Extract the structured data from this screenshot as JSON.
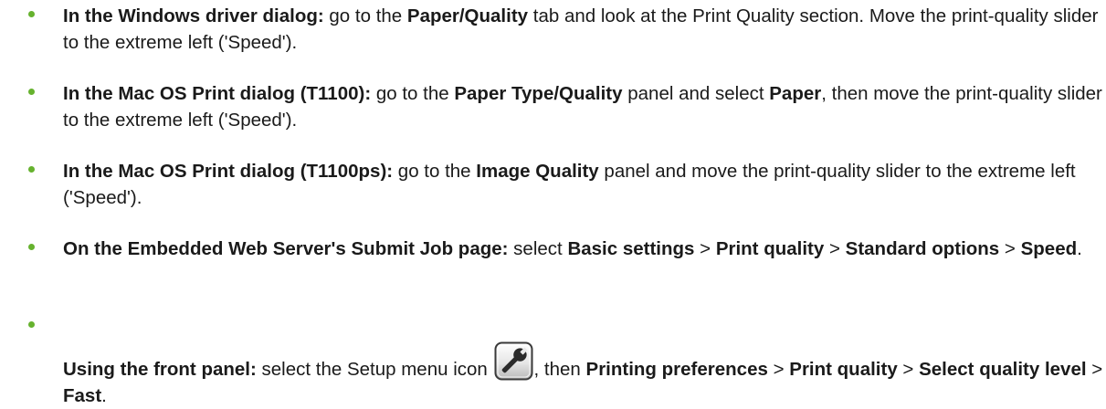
{
  "items": [
    {
      "lead": "In the Windows driver dialog:",
      "t1": " go to the ",
      "b1": "Paper/Quality",
      "t2": " tab and look at the Print Quality section. Move the print-quality slider to the extreme left ('Speed')."
    },
    {
      "lead": "In the Mac OS Print dialog (T1100):",
      "t1": " go to the ",
      "b1": "Paper Type/Quality",
      "t2": " panel and select ",
      "b2": "Paper",
      "t3": ", then move the print-quality slider to the extreme left ('Speed')."
    },
    {
      "lead": "In the Mac OS Print dialog (T1100ps):",
      "t1": " go to the ",
      "b1": "Image Quality",
      "t2": " panel and move the print-quality slider to the extreme left ('Speed')."
    },
    {
      "lead": "On the Embedded Web Server's Submit Job page:",
      "t1": " select ",
      "b1": "Basic settings",
      "t2": " > ",
      "b2": "Print quality",
      "t3": " > ",
      "b3": "Standard options",
      "t4": " > ",
      "b4": "Speed",
      "t5": "."
    },
    {
      "lead": "Using the front panel:",
      "t1": " select the Setup menu icon ",
      "icon": "wrench-icon",
      "t2": ", then ",
      "b1": "Printing preferences",
      "t3": " > ",
      "b2": "Print quality",
      "t4": " > ",
      "b3": "Select quality level",
      "t5": " > ",
      "b4": "Fast",
      "t6": "."
    }
  ],
  "colors": {
    "bullet": "#66b22e",
    "text": "#1a1a1a"
  }
}
